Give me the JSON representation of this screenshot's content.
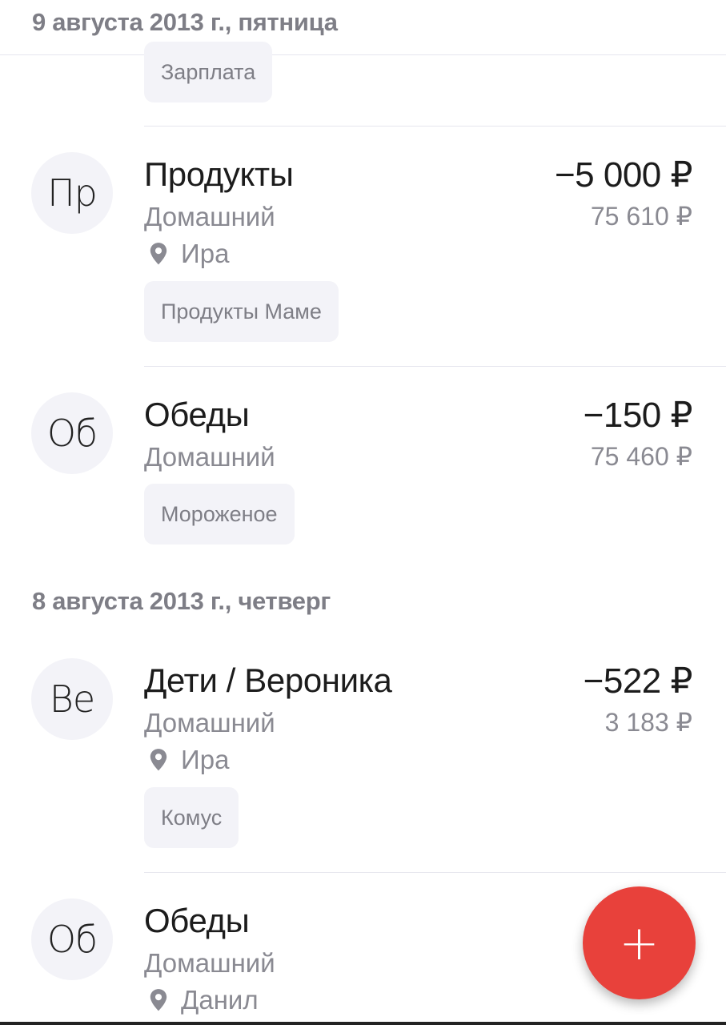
{
  "sections": [
    {
      "date": "9 августа 2013 г., пятница",
      "transactions": [
        {
          "tag": "Зарплата"
        },
        {
          "avatar": "Пр",
          "title": "Продукты",
          "account": "Домашний",
          "person": "Ира",
          "tag": "Продукты Маме",
          "amount": "−5 000 ₽",
          "balance": "75 610 ₽"
        },
        {
          "avatar": "Об",
          "title": "Обеды",
          "account": "Домашний",
          "tag": "Мороженое",
          "amount": "−150 ₽",
          "balance": "75 460 ₽"
        }
      ]
    },
    {
      "date": "8 августа 2013 г., четверг",
      "transactions": [
        {
          "avatar": "Ве",
          "title": "Дети / Вероника",
          "account": "Домашний",
          "person": "Ира",
          "tag": "Комус",
          "amount": "−522 ₽",
          "balance": "3 183 ₽"
        },
        {
          "avatar": "Об",
          "title": "Обеды",
          "account": "Домашний",
          "person": "Данил"
        }
      ]
    }
  ],
  "fab": {
    "icon": "plus-icon",
    "label": "+"
  },
  "colors": {
    "accent": "#e8413b",
    "avatar_bg": "#f3f3f8",
    "muted_text": "#8a8a92"
  }
}
